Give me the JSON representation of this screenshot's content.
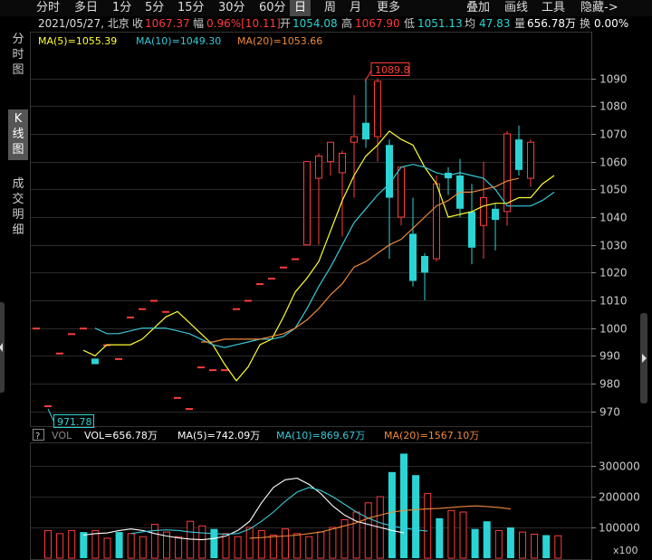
{
  "toolbar": {
    "periods": [
      "分时",
      "多日",
      "1分",
      "5分",
      "15分",
      "30分",
      "60分",
      "日",
      "周",
      "月",
      "更多"
    ],
    "active": "日",
    "tools": [
      "叠加",
      "画线",
      "工具",
      "隐藏->"
    ]
  },
  "info": {
    "date_loc": "2021/05/27, 北京",
    "close_label": "收",
    "close": "1067.37",
    "amp_label": "幅",
    "amp": "0.96%[10.11]",
    "open_label": "开",
    "open": "1054.08",
    "high_label": "高",
    "high": "1067.90",
    "low_label": "低",
    "low": "1051.13",
    "avg_label": "均",
    "avg": "47.83",
    "vol_label": "量",
    "vol": "656.78万",
    "turn_label": "换",
    "turn": "0.00%"
  },
  "sidebar": {
    "tabs": [
      "分时图",
      "K线图",
      "成交明细"
    ],
    "active": "K线图"
  },
  "ma_legend": {
    "ma5": "MA(5)=1055.39",
    "ma10": "MA(10)=1049.30",
    "ma20": "MA(20)=1053.66"
  },
  "vol_legend": {
    "q": "?",
    "vol_title": "VOL",
    "vol": "VOL=656.78万",
    "ma5": "MA(5)=742.09万",
    "ma10": "MA(10)=869.67万",
    "ma20": "MA(20)=1567.10万"
  },
  "colors": {
    "up": "#ff3c3c",
    "down": "#2bd4d4",
    "ma5": "#ffff33",
    "ma10": "#38c8d8",
    "ma20": "#ee8a3a",
    "vol_ma5": "#ffffff",
    "grid": "#2b2b2b"
  },
  "chart_data": [
    {
      "type": "candlestick",
      "ylim": [
        965,
        1100
      ],
      "y_ticks": [
        970,
        980,
        990,
        1000,
        1010,
        1020,
        1030,
        1040,
        1050,
        1060,
        1070,
        1080,
        1090
      ],
      "max_label": "1089.8",
      "min_label": "971.78",
      "candles": [
        {
          "o": 1000,
          "h": 1000,
          "l": 1000,
          "c": 1000
        },
        {
          "o": 972,
          "h": 972,
          "l": 972,
          "c": 972
        },
        {
          "o": 991,
          "h": 991,
          "l": 991,
          "c": 991
        },
        {
          "o": 998,
          "h": 998,
          "l": 998,
          "c": 998
        },
        {
          "o": 1000,
          "h": 1000,
          "l": 1000,
          "c": 1000
        },
        {
          "o": 989,
          "h": 989,
          "l": 987,
          "c": 987
        },
        {
          "o": 994,
          "h": 994,
          "l": 994,
          "c": 994
        },
        {
          "o": 989,
          "h": 989,
          "l": 989,
          "c": 989
        },
        {
          "o": 1004,
          "h": 1004,
          "l": 1004,
          "c": 1004
        },
        {
          "o": 1007,
          "h": 1007,
          "l": 1007,
          "c": 1007
        },
        {
          "o": 1010,
          "h": 1010,
          "l": 1010,
          "c": 1010
        },
        {
          "o": 1006,
          "h": 1006,
          "l": 1006,
          "c": 1006
        },
        {
          "o": 975,
          "h": 975,
          "l": 975,
          "c": 975
        },
        {
          "o": 971,
          "h": 971,
          "l": 971,
          "c": 971
        },
        {
          "o": 986,
          "h": 986,
          "l": 986,
          "c": 986
        },
        {
          "o": 985,
          "h": 985,
          "l": 985,
          "c": 985
        },
        {
          "o": 985,
          "h": 985,
          "l": 985,
          "c": 985
        },
        {
          "o": 1007,
          "h": 1007,
          "l": 1007,
          "c": 1007
        },
        {
          "o": 1010,
          "h": 1010,
          "l": 1010,
          "c": 1010
        },
        {
          "o": 1016,
          "h": 1016,
          "l": 1016,
          "c": 1016
        },
        {
          "o": 1018,
          "h": 1018,
          "l": 1018,
          "c": 1018
        },
        {
          "o": 1022,
          "h": 1022,
          "l": 1022,
          "c": 1022
        },
        {
          "o": 1025,
          "h": 1025,
          "l": 1025,
          "c": 1025
        },
        {
          "o": 1030,
          "h": 1060,
          "l": 1030,
          "c": 1060
        },
        {
          "o": 1054,
          "h": 1063,
          "l": 1030,
          "c": 1062
        },
        {
          "o": 1060,
          "h": 1067,
          "l": 1055,
          "c": 1067
        },
        {
          "o": 1056,
          "h": 1064,
          "l": 1033,
          "c": 1063
        },
        {
          "o": 1067,
          "h": 1084,
          "l": 1047,
          "c": 1069
        },
        {
          "o": 1074,
          "h": 1090,
          "l": 1065,
          "c": 1068
        },
        {
          "o": 1069,
          "h": 1090,
          "l": 1060,
          "c": 1089
        },
        {
          "o": 1066,
          "h": 1068,
          "l": 1025,
          "c": 1047
        },
        {
          "o": 1040,
          "h": 1057,
          "l": 1037,
          "c": 1058
        },
        {
          "o": 1034,
          "h": 1047,
          "l": 1015,
          "c": 1017
        },
        {
          "o": 1026,
          "h": 1027,
          "l": 1010,
          "c": 1020
        },
        {
          "o": 1025,
          "h": 1055,
          "l": 1024,
          "c": 1052
        },
        {
          "o": 1056,
          "h": 1058,
          "l": 1048,
          "c": 1054
        },
        {
          "o": 1055,
          "h": 1061,
          "l": 1040,
          "c": 1043
        },
        {
          "o": 1042,
          "h": 1052,
          "l": 1023,
          "c": 1029
        },
        {
          "o": 1037,
          "h": 1060,
          "l": 1025,
          "c": 1047
        },
        {
          "o": 1043,
          "h": 1045,
          "l": 1028,
          "c": 1039
        },
        {
          "o": 1042,
          "h": 1071,
          "l": 1037,
          "c": 1070
        },
        {
          "o": 1068,
          "h": 1073,
          "l": 1055,
          "c": 1057
        },
        {
          "o": 1054,
          "h": 1068,
          "l": 1051,
          "c": 1067
        }
      ],
      "ma5": [
        992,
        990,
        994,
        994,
        994,
        996,
        1000,
        1004,
        1006,
        1002,
        998,
        994,
        987,
        981,
        986,
        994,
        996,
        1004,
        1013,
        1018,
        1024,
        1035,
        1046,
        1055,
        1062,
        1066,
        1071,
        1068,
        1066,
        1058,
        1052,
        1040,
        1041,
        1042,
        1044,
        1045,
        1045,
        1047,
        1047,
        1052,
        1055
      ],
      "ma10": [
        1000,
        998,
        998,
        999,
        1000,
        1000,
        1000,
        999,
        998,
        996,
        994,
        993,
        994,
        995,
        996,
        996,
        997,
        1000,
        1007,
        1015,
        1022,
        1030,
        1038,
        1043,
        1048,
        1052,
        1058,
        1059,
        1058,
        1056,
        1055,
        1056,
        1055,
        1054,
        1050,
        1044,
        1044,
        1044,
        1046,
        1049
      ],
      "ma20": [
        995,
        995,
        996,
        996,
        996,
        996,
        997,
        998,
        1000,
        1003,
        1007,
        1012,
        1016,
        1022,
        1024,
        1027,
        1030,
        1032,
        1036,
        1040,
        1044,
        1046,
        1049,
        1049,
        1050,
        1051,
        1053,
        1054
      ]
    },
    {
      "type": "bar",
      "ylim": [
        0,
        350000
      ],
      "y_ticks": [
        100000,
        200000,
        300000
      ],
      "unit_label": "x100",
      "values": [
        90000,
        80000,
        90000,
        85000,
        90000,
        65000,
        85000,
        80000,
        70000,
        110000,
        85000,
        70000,
        120000,
        105000,
        95000,
        80000,
        70000,
        100000,
        90000,
        75000,
        95000,
        80000,
        70000,
        85000,
        100000,
        125000,
        150000,
        180000,
        200000,
        280000,
        340000,
        270000,
        210000,
        130000,
        155000,
        150000,
        95000,
        120000,
        90000,
        100000,
        85000,
        78000,
        75000,
        73000
      ],
      "up": [
        true,
        true,
        true,
        false,
        true,
        true,
        false,
        true,
        true,
        true,
        true,
        true,
        true,
        true,
        false,
        true,
        true,
        true,
        true,
        true,
        true,
        true,
        true,
        true,
        true,
        true,
        true,
        true,
        true,
        false,
        false,
        false,
        true,
        false,
        true,
        true,
        false,
        false,
        true,
        false,
        true,
        true,
        false,
        true
      ],
      "ma5": [
        75000,
        80000,
        82000,
        90000,
        95000,
        90000,
        80000,
        72000,
        66000,
        62000,
        60000,
        64000,
        72000,
        90000,
        120000,
        180000,
        230000,
        255000,
        260000,
        240000,
        210000,
        170000,
        140000,
        120000,
        110000,
        100000,
        90000,
        82000
      ],
      "ma10": [
        80000,
        86000,
        90000,
        92000,
        90000,
        85000,
        82000,
        80000,
        78000,
        80000,
        95000,
        120000,
        150000,
        185000,
        215000,
        230000,
        220000,
        200000,
        175000,
        150000,
        130000,
        115000,
        105000,
        98000,
        92000,
        88000
      ],
      "ma20": [
        65000,
        67000,
        70000,
        72000,
        75000,
        80000,
        85000,
        95000,
        105000,
        115000,
        130000,
        140000,
        150000,
        155000,
        158000,
        160000,
        162000,
        165000,
        168000,
        170000,
        168000,
        165000,
        160000
      ]
    }
  ]
}
